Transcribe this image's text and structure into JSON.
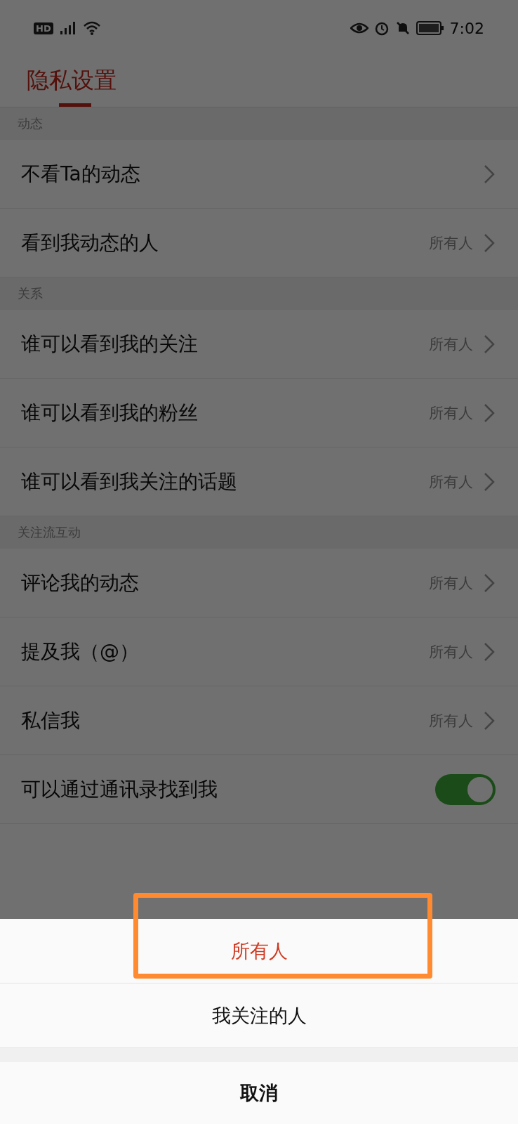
{
  "status_bar": {
    "badge": "HD",
    "time": "7:02"
  },
  "header": {
    "title": "隐私设置"
  },
  "sections": [
    {
      "title": "动态",
      "rows": [
        {
          "kind": "link",
          "label": "不看Ta的动态"
        },
        {
          "kind": "link",
          "label": "看到我动态的人",
          "value": "所有人"
        }
      ]
    },
    {
      "title": "关系",
      "rows": [
        {
          "kind": "link",
          "label": "谁可以看到我的关注",
          "value": "所有人"
        },
        {
          "kind": "link",
          "label": "谁可以看到我的粉丝",
          "value": "所有人"
        },
        {
          "kind": "link",
          "label": "谁可以看到我关注的话题",
          "value": "所有人"
        }
      ]
    },
    {
      "title": "关注流互动",
      "rows": [
        {
          "kind": "link",
          "label": "评论我的动态",
          "value": "所有人"
        },
        {
          "kind": "link",
          "label": "提及我（@）",
          "value": "所有人"
        },
        {
          "kind": "link",
          "label": "私信我",
          "value": "所有人"
        },
        {
          "kind": "toggle",
          "label": "可以通过通讯录找到我",
          "on": true
        }
      ]
    }
  ],
  "sheet": {
    "options": [
      {
        "label": "所有人",
        "selected": true,
        "highlighted": true
      },
      {
        "label": "我关注的人",
        "selected": false,
        "highlighted": false
      }
    ],
    "cancel": "取消"
  }
}
